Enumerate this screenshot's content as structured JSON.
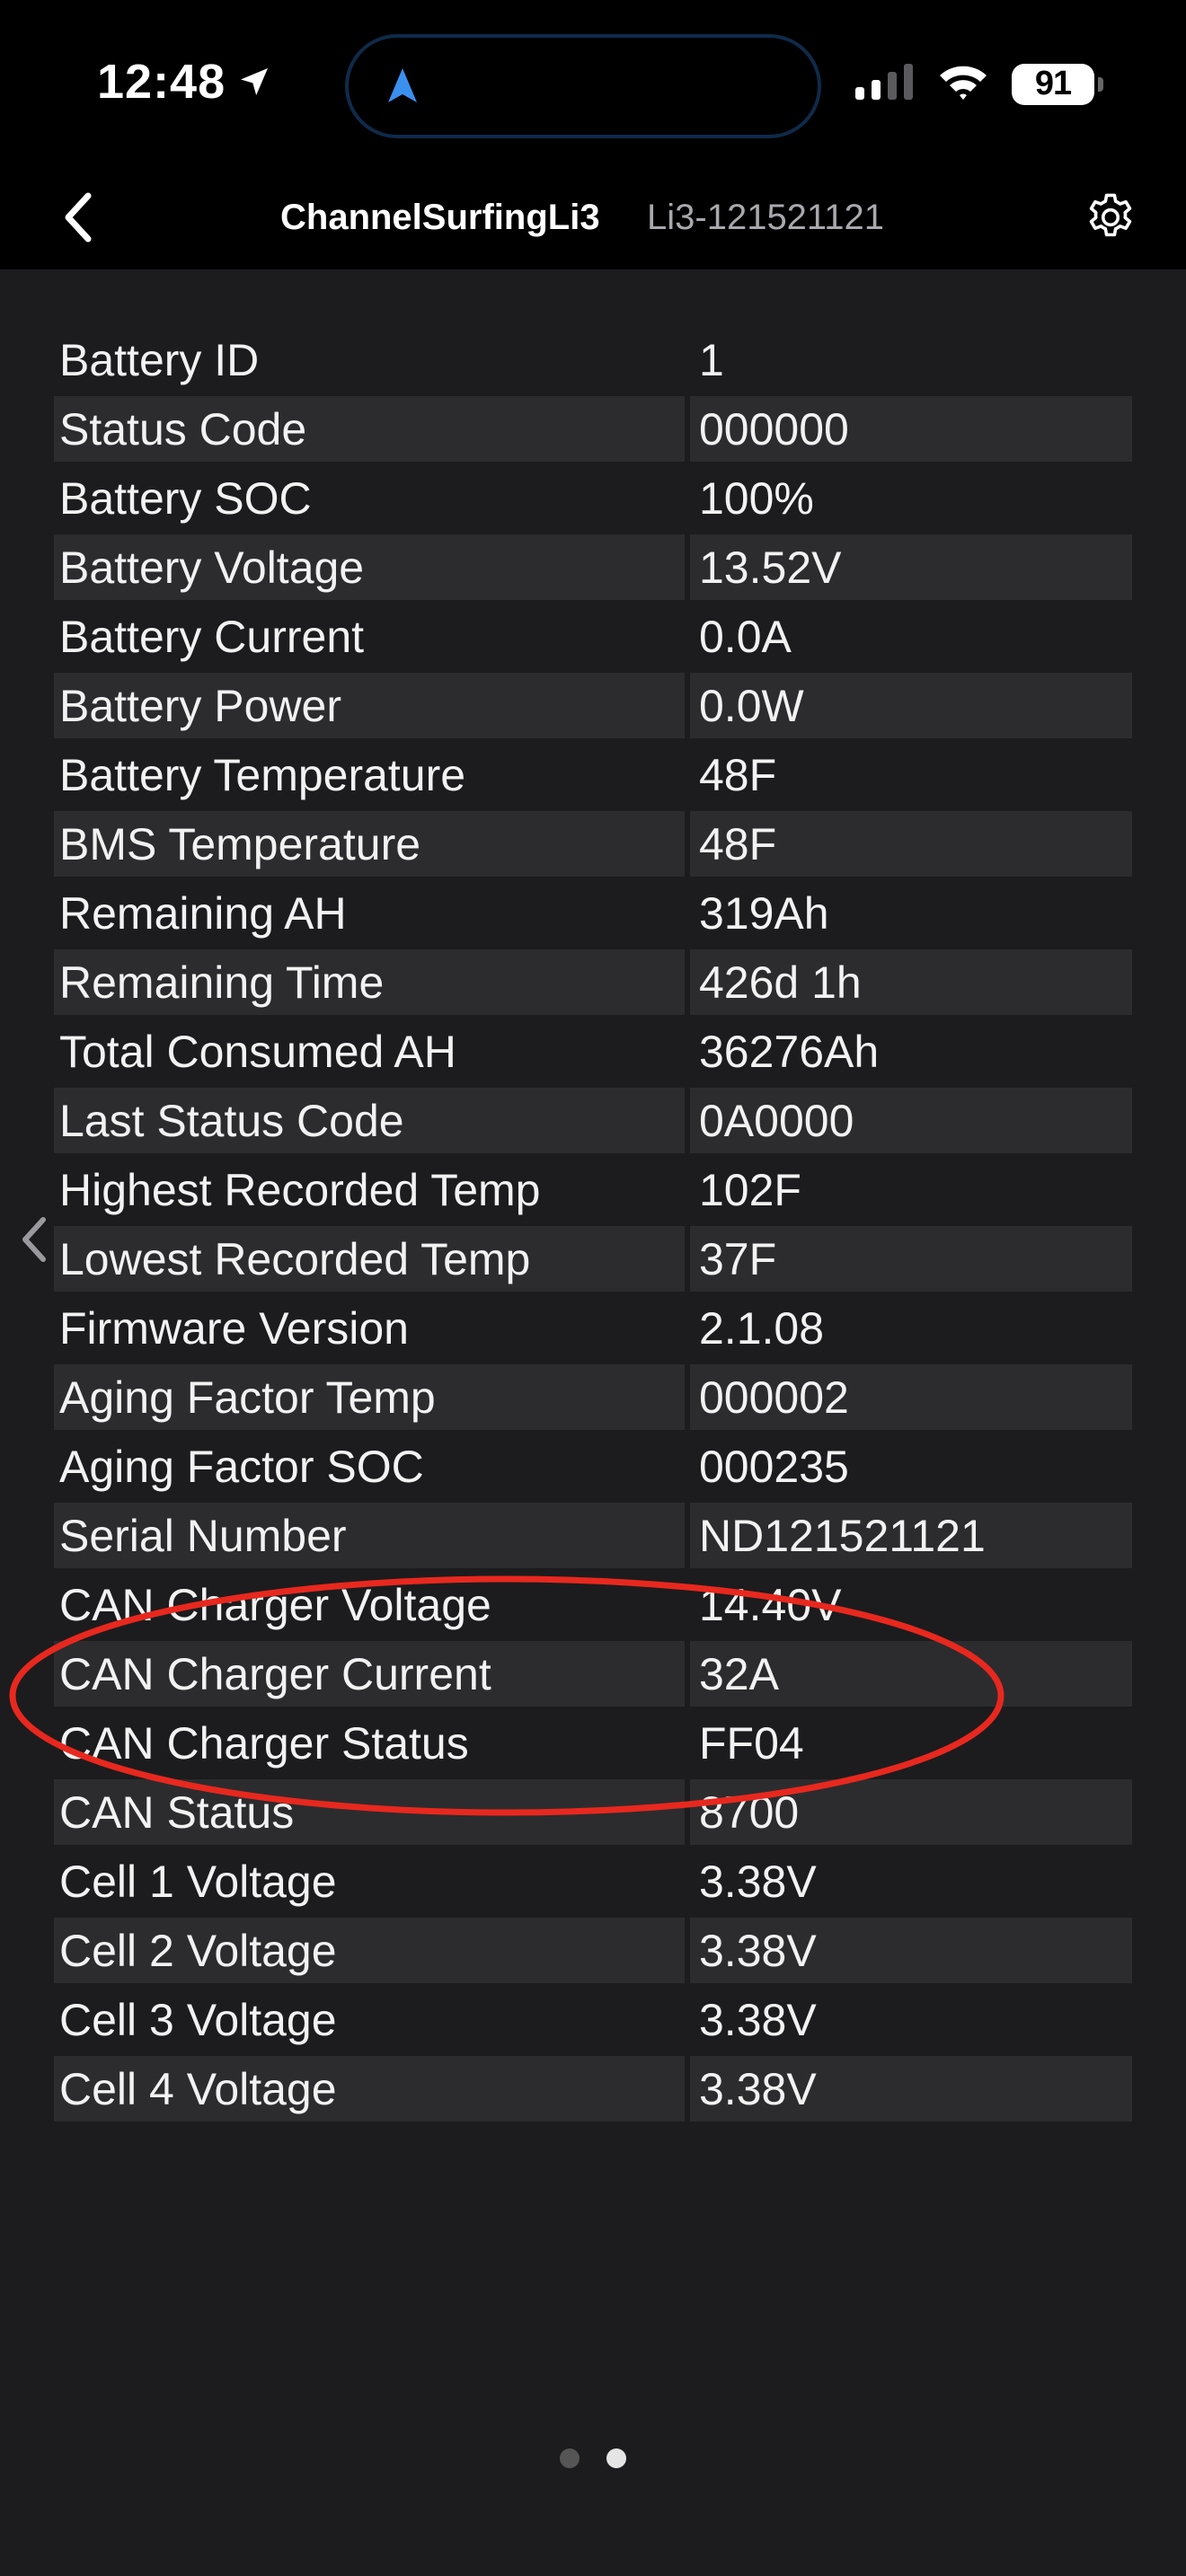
{
  "status_bar": {
    "time": "12:48",
    "battery_level": "91",
    "icons": [
      "location-arrow-icon",
      "navigation-icon",
      "cellular-signal-icon",
      "wifi-icon",
      "battery-icon"
    ]
  },
  "nav": {
    "title": "ChannelSurfingLi3",
    "subtitle": "Li3-121521121",
    "back_icon": "chevron-left-icon",
    "settings_icon": "gear-icon"
  },
  "rows": [
    {
      "label": "Battery ID",
      "value": "1"
    },
    {
      "label": "Status Code",
      "value": "000000"
    },
    {
      "label": "Battery SOC",
      "value": "100%"
    },
    {
      "label": "Battery Voltage",
      "value": "13.52V"
    },
    {
      "label": "Battery Current",
      "value": "0.0A"
    },
    {
      "label": "Battery Power",
      "value": "0.0W"
    },
    {
      "label": "Battery Temperature",
      "value": "48F"
    },
    {
      "label": "BMS Temperature",
      "value": "48F"
    },
    {
      "label": "Remaining AH",
      "value": "319Ah"
    },
    {
      "label": "Remaining Time",
      "value": "426d 1h"
    },
    {
      "label": "Total Consumed AH",
      "value": "36276Ah"
    },
    {
      "label": "Last Status Code",
      "value": "0A0000"
    },
    {
      "label": "Highest Recorded Temp",
      "value": "102F"
    },
    {
      "label": "Lowest Recorded Temp",
      "value": "37F"
    },
    {
      "label": "Firmware Version",
      "value": "2.1.08"
    },
    {
      "label": "Aging Factor Temp",
      "value": "000002"
    },
    {
      "label": "Aging Factor SOC",
      "value": "000235"
    },
    {
      "label": "Serial Number",
      "value": "ND121521121"
    },
    {
      "label": "CAN Charger Voltage",
      "value": "14.40V"
    },
    {
      "label": "CAN Charger Current",
      "value": "32A"
    },
    {
      "label": "CAN Charger Status",
      "value": "FF04"
    },
    {
      "label": "CAN Status",
      "value": "8700"
    },
    {
      "label": "Cell 1 Voltage",
      "value": "3.38V"
    },
    {
      "label": "Cell 2 Voltage",
      "value": "3.38V"
    },
    {
      "label": "Cell 3 Voltage",
      "value": "3.38V"
    },
    {
      "label": "Cell 4 Voltage",
      "value": "3.38V"
    }
  ],
  "pager": {
    "pages": 2,
    "active_page": 2
  },
  "colors": {
    "background": "#1c1c1e",
    "row_shade": "#2c2c2e",
    "annotation": "#e8281e",
    "accent": "#3b8fef"
  }
}
